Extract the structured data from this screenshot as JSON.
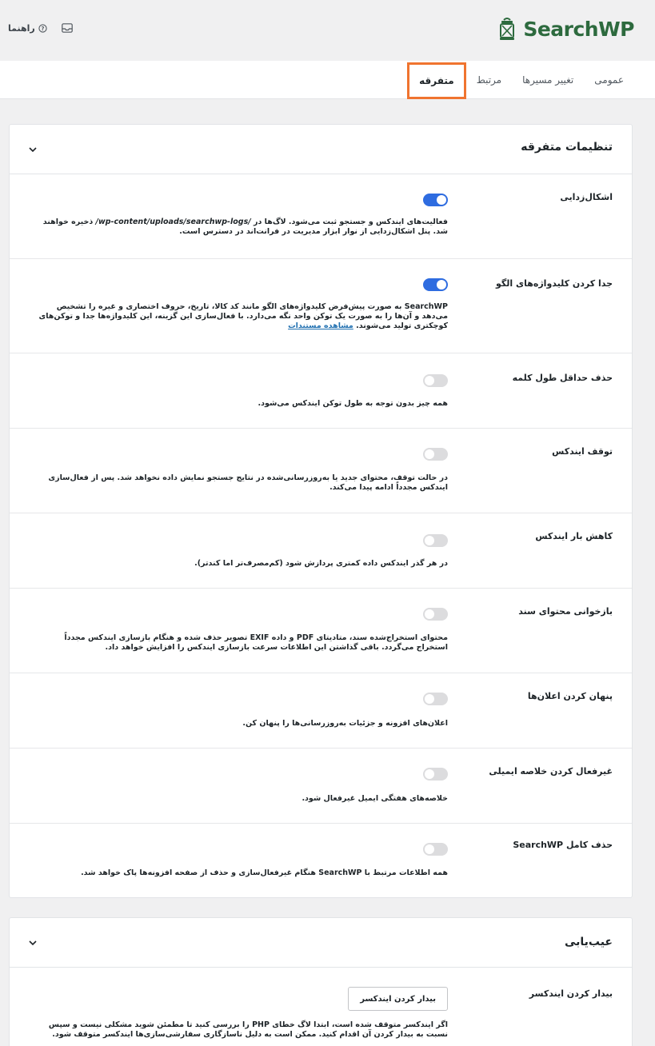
{
  "header": {
    "logo_text": "SearchWP",
    "help_label": "راهنما",
    "brand_color": "#2d6a3e"
  },
  "tabs": [
    {
      "label": "عمومی",
      "active": false
    },
    {
      "label": "تغییر مسیرها",
      "active": false
    },
    {
      "label": "مرتبط",
      "active": false
    },
    {
      "label": "متفرقه",
      "active": true
    }
  ],
  "misc_settings": {
    "title": "تنظیمات متفرقه",
    "rows": [
      {
        "label": "اشکال‌زدایی",
        "toggle": true,
        "desc_pre": "فعالیت‌های ایندکس و جستجو ثبت می‌شود. لاگ‌ها در",
        "desc_path": "/wp-content/uploads/searchwp-logs/",
        "desc_post": "ذخیره خواهند شد. پنل اشکال‌زدایی از نوار ابزار مدیریت در فرانت‌اند در دسترس است."
      },
      {
        "label": "جدا کردن کلیدواژه‌های الگو",
        "toggle": true,
        "desc": "SearchWP به صورت پیش‌فرض کلیدواژه‌های الگو مانند کد کالا، تاریخ، حروف اختصاری و غیره را تشخیص می‌دهد و آن‌ها را به صورت یک توکن واحد نگه می‌دارد. با فعال‌سازی این گزینه، این کلیدواژه‌ها جدا و توکن‌های کوچکتری تولید می‌شوند.",
        "link": "مشاهده مستندات"
      },
      {
        "label": "حذف حداقل طول کلمه",
        "toggle": false,
        "desc": "همه چیز بدون توجه به طول توکن ایندکس می‌شود."
      },
      {
        "label": "توقف ایندکس",
        "toggle": false,
        "desc": "در حالت توقف، محتوای جدید یا به‌روزرسانی‌شده در نتایج جستجو نمایش داده نخواهد شد. پس از فعال‌سازی ایندکس مجدداً ادامه پیدا می‌کند."
      },
      {
        "label": "کاهش بار ایندکس",
        "toggle": false,
        "desc": "در هر گذر ایندکس داده کمتری پردازش شود (کم‌مصرف‌تر اما کندتر)."
      },
      {
        "label": "بازخوانی محتوای سند",
        "toggle": false,
        "desc": "محتوای استخراج‌شده سند، متادیتای PDF و داده EXIF تصویر حذف شده و هنگام بازسازی ایندکس مجدداً استخراج می‌گردد. باقی گذاشتن این اطلاعات سرعت بازسازی ایندکس را افزایش خواهد داد."
      },
      {
        "label": "پنهان کردن اعلان‌ها",
        "toggle": false,
        "desc": "اعلان‌های افزونه و جزئیات به‌روزرسانی‌ها را پنهان کن."
      },
      {
        "label": "غیرفعال کردن خلاصه ایمیلی",
        "toggle": false,
        "desc": "خلاصه‌های هفتگی ایمیل غیرفعال شود."
      },
      {
        "label": "حذف کامل SearchWP",
        "toggle": false,
        "desc": "همه اطلاعات مرتبط با SearchWP هنگام غیرفعال‌سازی و حذف از صفحه افزونه‌ها پاک خواهد شد."
      }
    ]
  },
  "troubleshoot": {
    "title": "عیب‌یابی",
    "row_label": "بیدار کردن ایندکسر",
    "button_label": "بیدار کردن ایندکسر",
    "desc": "اگر ایندکسر متوقف شده است، ابتدا لاگ خطای PHP را بررسی کنید تا مطمئن شوید مشکلی نیست و سپس نسبت به بیدار کردن آن اقدام کنید. ممکن است به دلیل ناسازگاری سفارشی‌سازی‌ها ایندکسر متوقف شود."
  },
  "colors": {
    "toggle_on": "#2e6ce0",
    "toggle_off": "#dcdcde",
    "active_tab_outline": "#f0742f",
    "link": "#2271b1"
  }
}
